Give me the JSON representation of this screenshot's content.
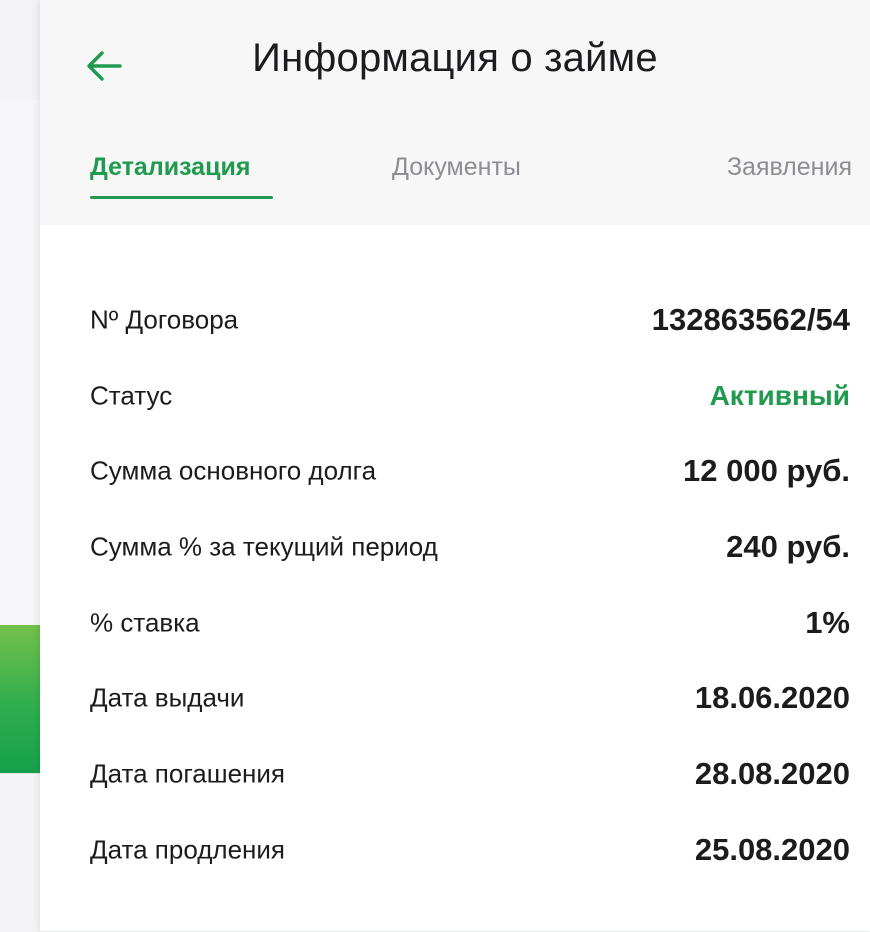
{
  "header": {
    "title": "Информация о займе",
    "back_icon": "arrow-left-icon"
  },
  "tabs": [
    {
      "label": "Детализация",
      "active": true
    },
    {
      "label": "Документы",
      "active": false
    },
    {
      "label": "Заявления",
      "active": false
    }
  ],
  "details": [
    {
      "label": "Nº Договора",
      "value": "132863562/54"
    },
    {
      "label": "Статус",
      "value": "Активный"
    },
    {
      "label": "Сумма основного долга",
      "value": "12 000 руб."
    },
    {
      "label": "Сумма % за текущий период",
      "value": "240 руб."
    },
    {
      "label": "% ставка",
      "value": "1%"
    },
    {
      "label": "Дата выдачи",
      "value": "18.06.2020"
    },
    {
      "label": "Дата погашения",
      "value": "28.08.2020"
    },
    {
      "label": "Дата продления",
      "value": "25.08.2020"
    }
  ],
  "colors": {
    "accent": "#1f9a4e",
    "text": "#1c1c1e",
    "muted": "#8d8d93"
  }
}
